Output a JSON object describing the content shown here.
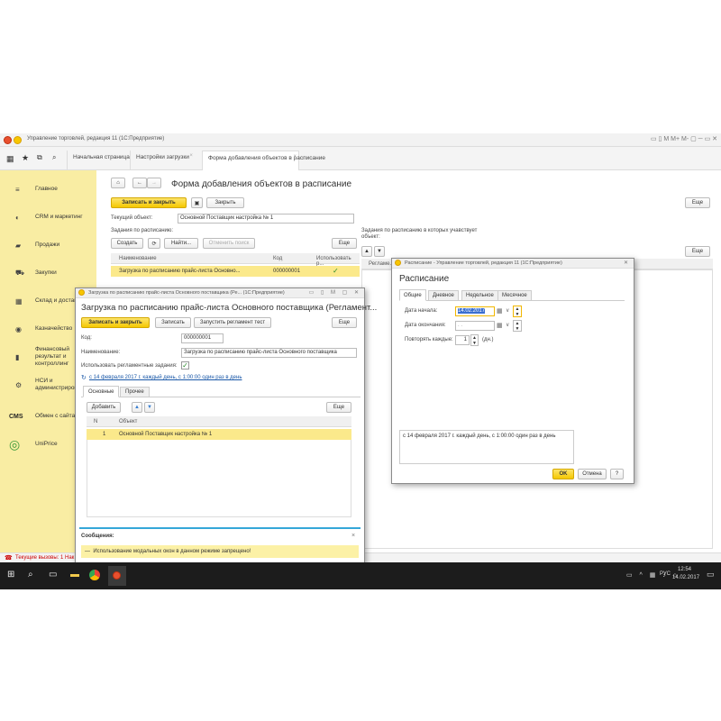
{
  "app": {
    "title": "Управление торговлей, редакция 11  (1С:Предприятие)",
    "controls": "▭ ▯ M M+ M- ▢ ─ ▭ ✕"
  },
  "tabs": [
    {
      "label": "Начальная страница"
    },
    {
      "label": "Настройки загрузки"
    },
    {
      "label": "Форма добавления объектов в расписание"
    }
  ],
  "sidebar": [
    {
      "icon": "menu-icon",
      "glyph": "≡",
      "label": "Главное"
    },
    {
      "icon": "crm-icon",
      "glyph": "◐",
      "label": "CRM и маркетинг"
    },
    {
      "icon": "bag-icon",
      "glyph": "▰",
      "label": "Продажи"
    },
    {
      "icon": "cart-icon",
      "glyph": "⛟",
      "label": "Закупки"
    },
    {
      "icon": "warehouse-icon",
      "glyph": "▦",
      "label": "Склад и доставка"
    },
    {
      "icon": "treasury-icon",
      "glyph": "◉",
      "label": "Казначейство"
    },
    {
      "icon": "finance-icon",
      "glyph": "▮",
      "label": "Финансовый результат и контроллинг"
    },
    {
      "icon": "gear-icon",
      "glyph": "⚙",
      "label": "НСИ и администрирование"
    },
    {
      "icon": "cms-icon",
      "glyph": "CMS",
      "label": "Обмен с сайтами"
    },
    {
      "icon": "uniprice-icon",
      "glyph": "◎",
      "label": "UniPrice"
    }
  ],
  "main": {
    "title": "Форма добавления объектов в расписание",
    "save_close": "Записать и закрыть",
    "close": "Закрыть",
    "more": "Еще",
    "current_label": "Текущий объект:",
    "current_value": "Основной Поставщик настройка № 1",
    "tasks_label": "Задания по расписанию:",
    "create": "Создать",
    "find": "Найти...",
    "cancel_search": "Отменить поиск",
    "col_name": "Наименование",
    "col_code": "Код",
    "col_use": "Использовать р...",
    "row_name": "Загрузка по расписанию прайс-листа Основно...",
    "row_code": "000000001",
    "row_check": "✓",
    "right_label": "Задания по расписанию в которых учавствует объект:",
    "right_col": "Регламе..."
  },
  "dlg1": {
    "title": "Загрузка по расписанию прайс-листа Основного поставщика (Ре... (1С:Предприятие)",
    "heading": "Загрузка по расписанию прайс-листа Основного поставщика (Регламент...",
    "save_close": "Записать и закрыть",
    "save": "Записать",
    "run": "Запустить регламент тест",
    "more": "Еще",
    "code_label": "Код:",
    "code_value": "000000001",
    "name_label": "Наименование:",
    "name_value": "Загрузка по расписанию прайс-листа Основного поставщика",
    "use_label": "Использовать регламентные задания:",
    "use_check": "✓",
    "schedule_link": "с 14 февраля 2017 г. каждый  день, с 1:00:00 один раз в день",
    "tab_main": "Основные",
    "tab_other": "Прочее",
    "add": "Добавить",
    "more2": "Еще",
    "col_n": "N",
    "col_obj": "Объект",
    "row_n": "1",
    "row_obj": "Основной Поставщик настройка № 1",
    "msg_title": "Сообщения:",
    "msg_text": "Использование модальных окон в данном режиме запрещено!"
  },
  "dlg2": {
    "title": "Расписание - Управление торговлей, редакция 11  (1С:Предприятие)",
    "heading": "Расписание",
    "tabs": [
      "Общие",
      "Дневное",
      "Недельное",
      "Месячное"
    ],
    "start_label": "Дата начала:",
    "start_value": "14.02.2017",
    "end_label": "Дата окончания:",
    "end_value": ".  .",
    "repeat_label": "Повторять каждые:",
    "repeat_value": "1",
    "repeat_unit": "(дн.)",
    "summary": "с 14 февраля 2017 г. каждый  день, с 1:00:00 один раз в день",
    "ok": "OK",
    "cancel": "Отмена",
    "help": "?"
  },
  "status": {
    "text": "Текущие вызовы: 1   Нак"
  },
  "taskbar": {
    "lang": "РУС",
    "time": "12:54",
    "date": "14.02.2017"
  }
}
